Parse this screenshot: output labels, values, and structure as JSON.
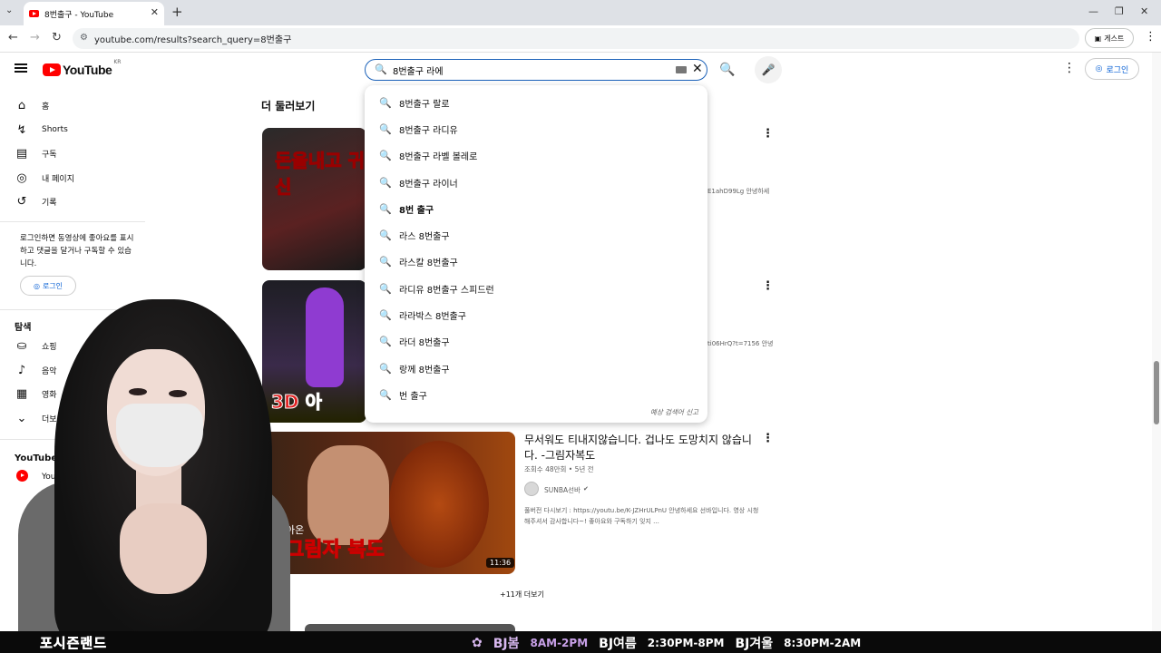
{
  "browser": {
    "tab_title": "8번출구 - YouTube",
    "url": "youtube.com/results?search_query=8번출구",
    "guest_label": "게스트"
  },
  "header": {
    "logo_text": "YouTube",
    "logo_region": "KR",
    "search_value": "8번출구 라에",
    "login_label": "로그인"
  },
  "sidebar": {
    "items": [
      {
        "label": "홈",
        "icon": "home-icon"
      },
      {
        "label": "Shorts",
        "icon": "shorts-icon"
      },
      {
        "label": "구독",
        "icon": "subscriptions-icon"
      },
      {
        "label": "내 페이지",
        "icon": "account-icon"
      },
      {
        "label": "기록",
        "icon": "history-icon"
      }
    ],
    "note": "로그인하면 동영상에 좋아요를 표시하고 댓글을 달거나 구독할 수 있습니다.",
    "login_label": "로그인",
    "explore_header": "탐색",
    "explore_items": [
      {
        "label": "쇼핑",
        "icon": "shopping-icon"
      },
      {
        "label": "음악",
        "icon": "music-icon"
      },
      {
        "label": "영화",
        "icon": "movie-icon"
      },
      {
        "label": "더보기",
        "icon": "chevron-down-icon"
      }
    ],
    "more_header": "YouTube 더보기",
    "more_items": [
      {
        "label": "YouTube Pr"
      }
    ]
  },
  "main": {
    "section_title": "더 둘러보기",
    "video1": {
      "thumb_text": "돈을내고 귀신",
      "desc_trunc": "E1ahD99Lg 안녕하세"
    },
    "video2": {
      "thumb_text": "3D 아",
      "desc_trunc": "ti06HrQ?t=7156 안녕"
    },
    "video3": {
      "title": "무서워도 티내지않습니다. 겁나도 도망치지 않습니다. -그림자복도",
      "meta": "조회수 48만회 • 5년 전",
      "channel": "SUNBA선바",
      "verified": "✔",
      "description": "풀버전 다시보기 : https://youtu.be/K-JZHrULPnU 안녕하세요 선바입니다. 영상 시청해주셔서 감사합니다~! 좋아요와 구독하기 잊지 ...",
      "duration": "11:36",
      "thumb_sub": "아온",
      "thumb_text": "그림자 복도"
    },
    "more_label": "+11개 더보기"
  },
  "suggestions": [
    "8번출구 랄로",
    "8번출구 라디유",
    "8번출구 라벨 볼레로",
    "8번출구 라이너",
    "8번 출구",
    "라스 8번출구",
    "라스칼 8번출구",
    "라디유 8번출구 스피드런",
    "라라박스 8번출구",
    "라더 8번출구",
    "랑께 8번출구",
    "번 출구"
  ],
  "report_label": "예상 검색어 신고",
  "banner": {
    "left": "포시즌랜드",
    "spring": "BJ봄",
    "spring_time": "8AM-2PM",
    "summer": "BJ여름",
    "summer_time": "2:30PM-8PM",
    "winter": "BJ겨울",
    "winter_time": "8:30PM-2AM"
  }
}
